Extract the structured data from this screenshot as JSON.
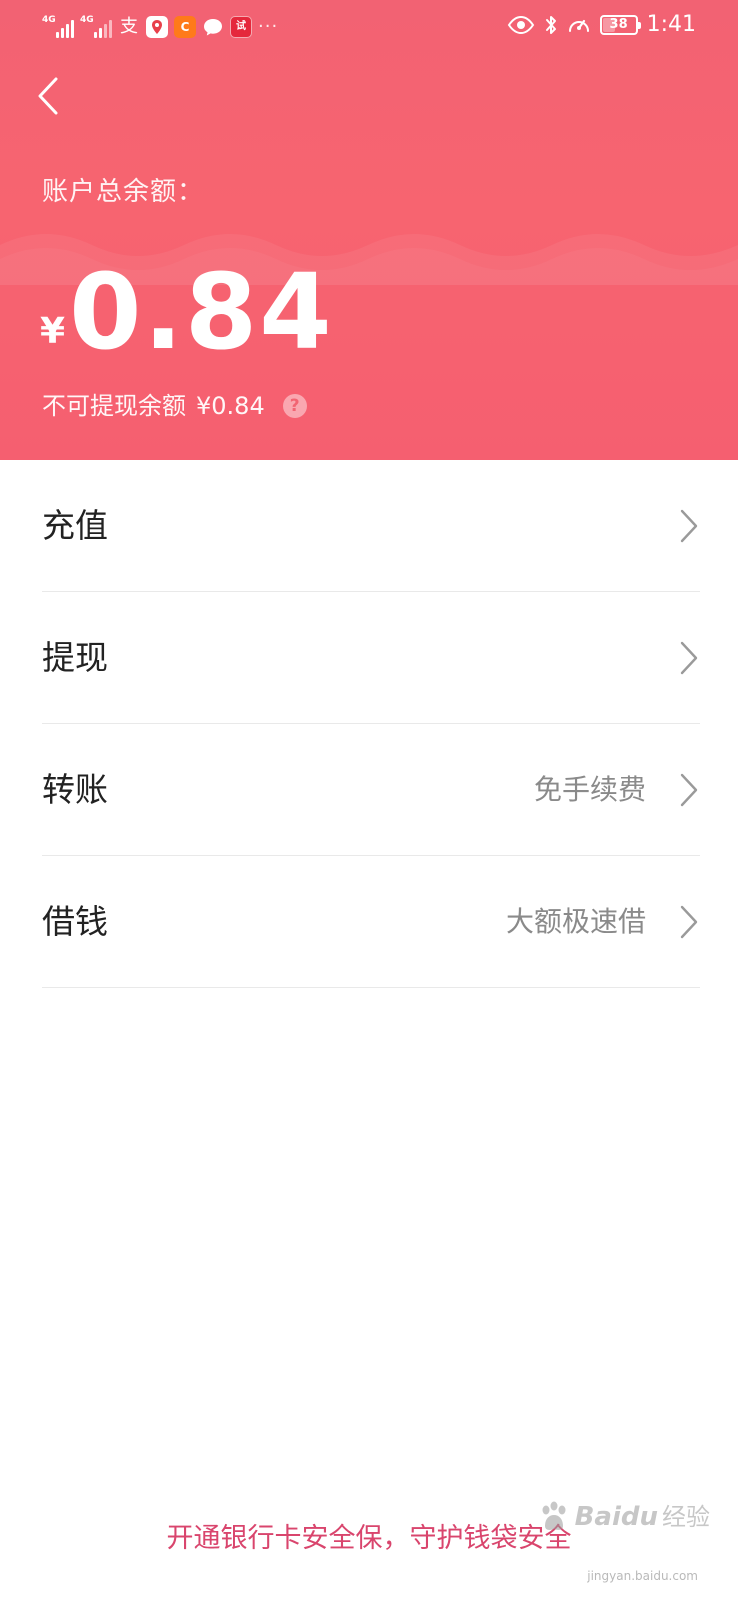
{
  "status_bar": {
    "network_1": "4G",
    "network_2": "4G",
    "alipay_glyph": "支",
    "app_icon_2": "C",
    "app_icon_4": "试",
    "more_indicator": "···",
    "battery": "38",
    "battery_level": 0.38,
    "time": "1:41"
  },
  "header": {
    "back_icon": "chevron-left-icon",
    "balance_label": "账户总余额：",
    "currency": "¥",
    "balance": "0.84",
    "non_withdrawable_label": "不可提现余额",
    "non_withdrawable_amount": "¥0.84",
    "help_icon": "?"
  },
  "menu": [
    {
      "label": "充值",
      "hint": ""
    },
    {
      "label": "提现",
      "hint": ""
    },
    {
      "label": "转账",
      "hint": "免手续费"
    },
    {
      "label": "借钱",
      "hint": "大额极速借"
    }
  ],
  "footer": {
    "banner": "开通银行卡安全保，守护钱袋安全"
  },
  "watermark": {
    "brand": "Bai",
    "brand_suffix": "du",
    "brand_cn": "经验",
    "url": "jingyan.baidu.com"
  },
  "colors": {
    "header_gradient_top": "#f26273",
    "header_gradient_bottom": "#f55f70",
    "footer_text": "#d9456d",
    "menu_hint": "#8a8a8a"
  }
}
